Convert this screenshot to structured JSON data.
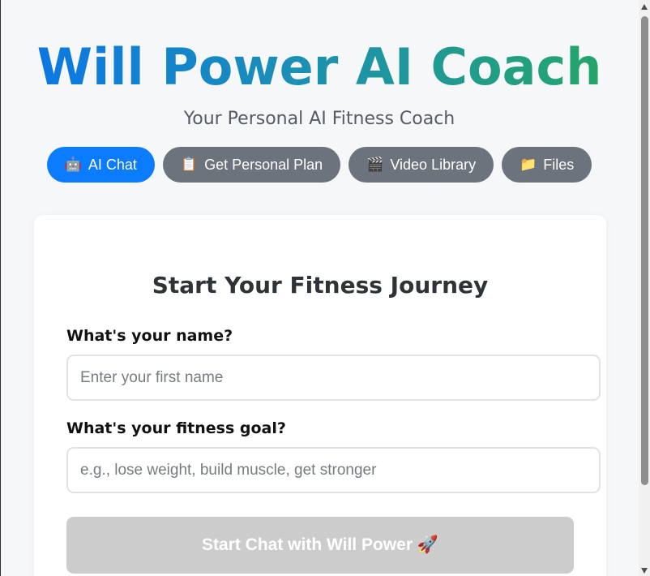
{
  "header": {
    "title": "Will Power AI Coach",
    "subtitle": "Your Personal AI Fitness Coach"
  },
  "nav": {
    "tabs": [
      {
        "icon": "🤖",
        "icon_name": "robot-icon",
        "label": "AI Chat",
        "active": true
      },
      {
        "icon": "📋",
        "icon_name": "clipboard-icon",
        "label": "Get Personal Plan",
        "active": false
      },
      {
        "icon": "🎬",
        "icon_name": "clapperboard-icon",
        "label": "Video Library",
        "active": false
      },
      {
        "icon": "📁",
        "icon_name": "folder-icon",
        "label": "Files",
        "active": false
      }
    ]
  },
  "form": {
    "title": "Start Your Fitness Journey",
    "name_label": "What's your name?",
    "name_placeholder": "Enter your first name",
    "name_value": "",
    "goal_label": "What's your fitness goal?",
    "goal_placeholder": "e.g., lose weight, build muscle, get stronger",
    "goal_value": "",
    "submit_label": "Start Chat with Will Power 🚀",
    "submit_icon": "rocket-icon"
  },
  "colors": {
    "accent": "#0b7bff",
    "tab_inactive": "#6c737d",
    "title_gradient_start": "#0b78e3",
    "title_gradient_end": "#25a56a",
    "submit_disabled": "#cccccc"
  }
}
